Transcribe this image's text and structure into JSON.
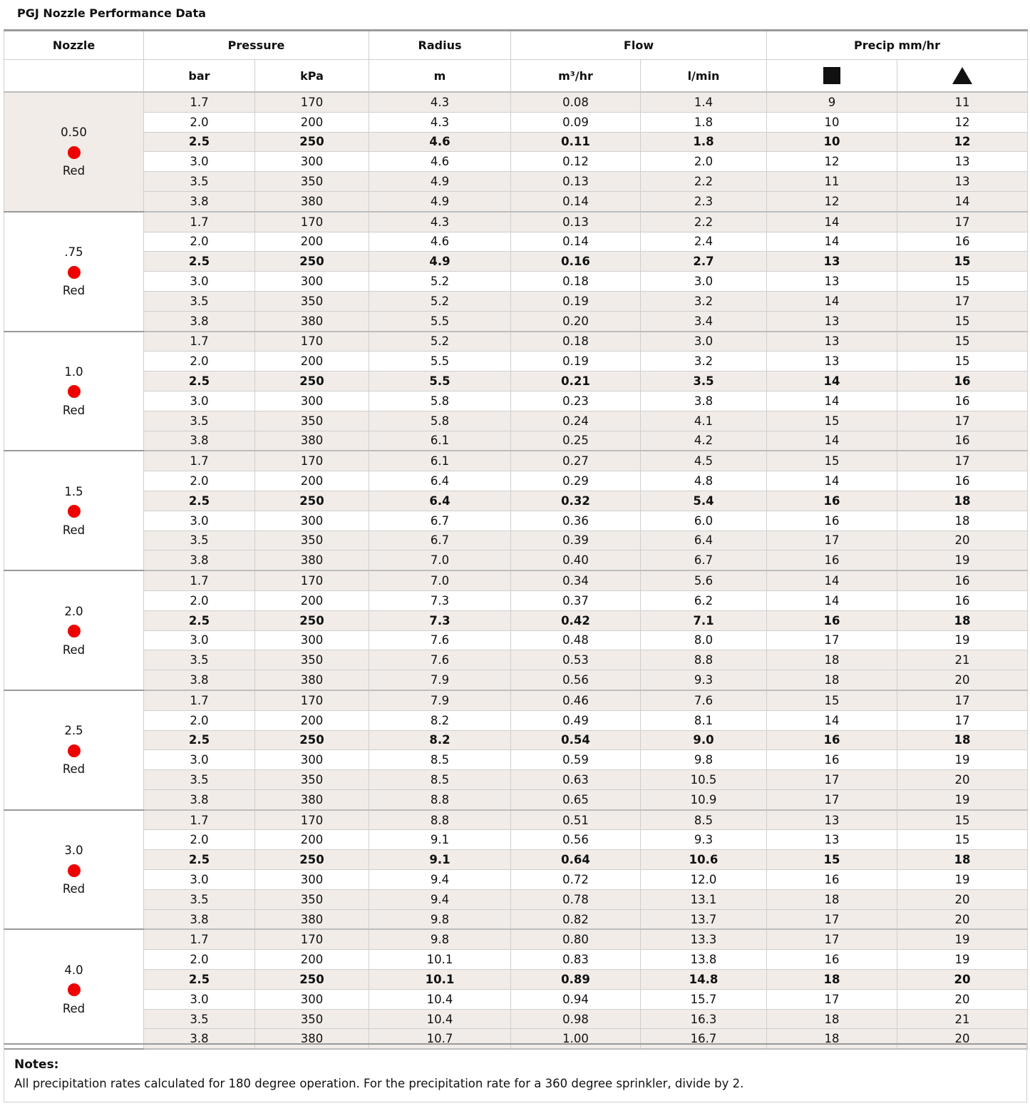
{
  "title": "PGJ Nozzle Performance Data",
  "columns": {
    "nozzle": "Nozzle",
    "pressure": "Pressure",
    "radius": "Radius",
    "flow": "Flow",
    "precip": "Precip mm/hr",
    "units": {
      "bar": "bar",
      "kpa": "kPa",
      "m": "m",
      "m3hr": "m³/hr",
      "lmin": "l/min",
      "square_icon": "square-icon",
      "triangle_icon": "triangle-icon"
    }
  },
  "nozzle_color": "#ee0000",
  "nozzles": [
    {
      "size": "0.50",
      "color_name": "Red",
      "rows": [
        [
          "1.7",
          "170",
          "4.3",
          "0.08",
          "1.4",
          "9",
          "11"
        ],
        [
          "2.0",
          "200",
          "4.3",
          "0.09",
          "1.8",
          "10",
          "12"
        ],
        [
          "2.5",
          "250",
          "4.6",
          "0.11",
          "1.8",
          "10",
          "12"
        ],
        [
          "3.0",
          "300",
          "4.6",
          "0.12",
          "2.0",
          "12",
          "13"
        ],
        [
          "3.5",
          "350",
          "4.9",
          "0.13",
          "2.2",
          "11",
          "13"
        ],
        [
          "3.8",
          "380",
          "4.9",
          "0.14",
          "2.3",
          "12",
          "14"
        ]
      ]
    },
    {
      "size": ".75",
      "color_name": "Red",
      "rows": [
        [
          "1.7",
          "170",
          "4.3",
          "0.13",
          "2.2",
          "14",
          "17"
        ],
        [
          "2.0",
          "200",
          "4.6",
          "0.14",
          "2.4",
          "14",
          "16"
        ],
        [
          "2.5",
          "250",
          "4.9",
          "0.16",
          "2.7",
          "13",
          "15"
        ],
        [
          "3.0",
          "300",
          "5.2",
          "0.18",
          "3.0",
          "13",
          "15"
        ],
        [
          "3.5",
          "350",
          "5.2",
          "0.19",
          "3.2",
          "14",
          "17"
        ],
        [
          "3.8",
          "380",
          "5.5",
          "0.20",
          "3.4",
          "13",
          "15"
        ]
      ]
    },
    {
      "size": "1.0",
      "color_name": "Red",
      "rows": [
        [
          "1.7",
          "170",
          "5.2",
          "0.18",
          "3.0",
          "13",
          "15"
        ],
        [
          "2.0",
          "200",
          "5.5",
          "0.19",
          "3.2",
          "13",
          "15"
        ],
        [
          "2.5",
          "250",
          "5.5",
          "0.21",
          "3.5",
          "14",
          "16"
        ],
        [
          "3.0",
          "300",
          "5.8",
          "0.23",
          "3.8",
          "14",
          "16"
        ],
        [
          "3.5",
          "350",
          "5.8",
          "0.24",
          "4.1",
          "15",
          "17"
        ],
        [
          "3.8",
          "380",
          "6.1",
          "0.25",
          "4.2",
          "14",
          "16"
        ]
      ]
    },
    {
      "size": "1.5",
      "color_name": "Red",
      "rows": [
        [
          "1.7",
          "170",
          "6.1",
          "0.27",
          "4.5",
          "15",
          "17"
        ],
        [
          "2.0",
          "200",
          "6.4",
          "0.29",
          "4.8",
          "14",
          "16"
        ],
        [
          "2.5",
          "250",
          "6.4",
          "0.32",
          "5.4",
          "16",
          "18"
        ],
        [
          "3.0",
          "300",
          "6.7",
          "0.36",
          "6.0",
          "16",
          "18"
        ],
        [
          "3.5",
          "350",
          "6.7",
          "0.39",
          "6.4",
          "17",
          "20"
        ],
        [
          "3.8",
          "380",
          "7.0",
          "0.40",
          "6.7",
          "16",
          "19"
        ]
      ]
    },
    {
      "size": "2.0",
      "color_name": "Red",
      "rows": [
        [
          "1.7",
          "170",
          "7.0",
          "0.34",
          "5.6",
          "14",
          "16"
        ],
        [
          "2.0",
          "200",
          "7.3",
          "0.37",
          "6.2",
          "14",
          "16"
        ],
        [
          "2.5",
          "250",
          "7.3",
          "0.42",
          "7.1",
          "16",
          "18"
        ],
        [
          "3.0",
          "300",
          "7.6",
          "0.48",
          "8.0",
          "17",
          "19"
        ],
        [
          "3.5",
          "350",
          "7.6",
          "0.53",
          "8.8",
          "18",
          "21"
        ],
        [
          "3.8",
          "380",
          "7.9",
          "0.56",
          "9.3",
          "18",
          "20"
        ]
      ]
    },
    {
      "size": "2.5",
      "color_name": "Red",
      "rows": [
        [
          "1.7",
          "170",
          "7.9",
          "0.46",
          "7.6",
          "15",
          "17"
        ],
        [
          "2.0",
          "200",
          "8.2",
          "0.49",
          "8.1",
          "14",
          "17"
        ],
        [
          "2.5",
          "250",
          "8.2",
          "0.54",
          "9.0",
          "16",
          "18"
        ],
        [
          "3.0",
          "300",
          "8.5",
          "0.59",
          "9.8",
          "16",
          "19"
        ],
        [
          "3.5",
          "350",
          "8.5",
          "0.63",
          "10.5",
          "17",
          "20"
        ],
        [
          "3.8",
          "380",
          "8.8",
          "0.65",
          "10.9",
          "17",
          "19"
        ]
      ]
    },
    {
      "size": "3.0",
      "color_name": "Red",
      "rows": [
        [
          "1.7",
          "170",
          "8.8",
          "0.51",
          "8.5",
          "13",
          "15"
        ],
        [
          "2.0",
          "200",
          "9.1",
          "0.56",
          "9.3",
          "13",
          "15"
        ],
        [
          "2.5",
          "250",
          "9.1",
          "0.64",
          "10.6",
          "15",
          "18"
        ],
        [
          "3.0",
          "300",
          "9.4",
          "0.72",
          "12.0",
          "16",
          "19"
        ],
        [
          "3.5",
          "350",
          "9.4",
          "0.78",
          "13.1",
          "18",
          "20"
        ],
        [
          "3.8",
          "380",
          "9.8",
          "0.82",
          "13.7",
          "17",
          "20"
        ]
      ]
    },
    {
      "size": "4.0",
      "color_name": "Red",
      "rows": [
        [
          "1.7",
          "170",
          "9.8",
          "0.80",
          "13.3",
          "17",
          "19"
        ],
        [
          "2.0",
          "200",
          "10.1",
          "0.83",
          "13.8",
          "16",
          "19"
        ],
        [
          "2.5",
          "250",
          "10.1",
          "0.89",
          "14.8",
          "18",
          "20"
        ],
        [
          "3.0",
          "300",
          "10.4",
          "0.94",
          "15.7",
          "17",
          "20"
        ],
        [
          "3.5",
          "350",
          "10.4",
          "0.98",
          "16.3",
          "18",
          "21"
        ],
        [
          "3.8",
          "380",
          "10.7",
          "1.00",
          "16.7",
          "18",
          "20"
        ]
      ]
    }
  ],
  "notes": {
    "heading": "Notes:",
    "text": "All precipitation rates calculated for 180 degree operation. For the precipitation rate for a 360 degree sprinkler, divide by 2."
  }
}
